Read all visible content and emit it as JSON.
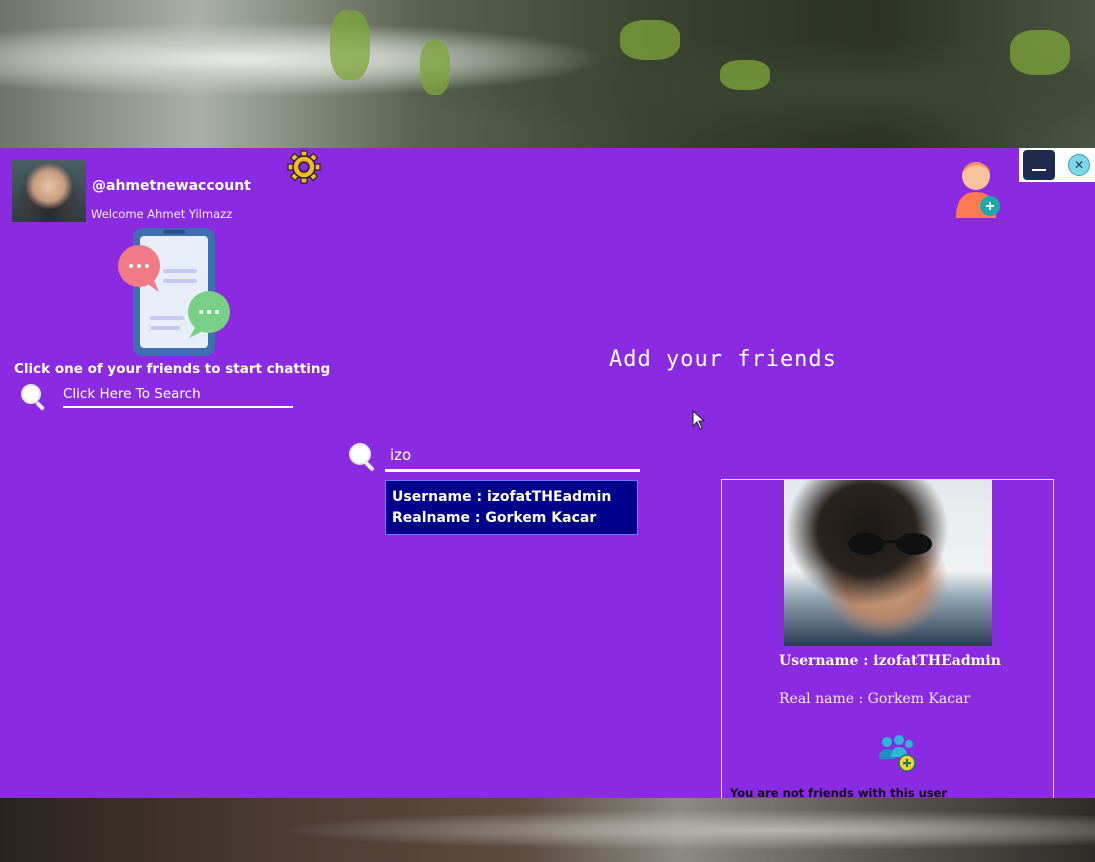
{
  "user": {
    "handle": "@ahmetnewaccount",
    "welcome": "Welcome Ahmet Yilmazz"
  },
  "chat_hint": "Click one of your friends to start chatting",
  "friend_search": {
    "placeholder": "Click Here To Search"
  },
  "main": {
    "heading": "Add your friends",
    "search_value": "izo",
    "result": {
      "username_line": "Username : izofatTHEadmin",
      "realname_line": "Realname : Gorkem Kacar"
    }
  },
  "profile": {
    "username_line": "Username : izofatTHEadmin",
    "realname_line": "Real name : Gorkem Kacar",
    "status": "You are not friends with this user"
  },
  "colors": {
    "panel": "#8a2be2",
    "result_bg": "#00008b",
    "accent_icon": "#f5a623"
  },
  "icons": [
    "gear-icon",
    "search-icon",
    "add-friend-icon",
    "minimize-icon",
    "close-icon",
    "add-user-icon"
  ]
}
